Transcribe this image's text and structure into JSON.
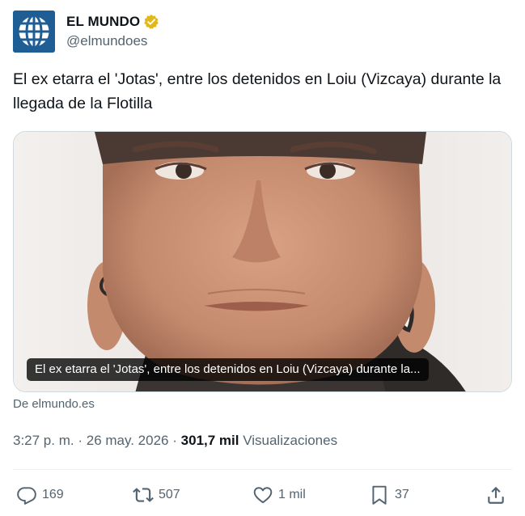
{
  "account": {
    "name": "EL MUNDO",
    "handle": "@elmundoes"
  },
  "tweet": {
    "text": "El ex etarra el 'Jotas', entre los detenidos en Loiu (Vizcaya) durante la llegada de la Flotilla"
  },
  "card": {
    "title": "El ex etarra el 'Jotas', entre los detenidos en Loiu (Vizcaya) durante la...",
    "source": "De elmundo.es"
  },
  "meta": {
    "time": "3:27 p. m.",
    "separator": "·",
    "date": "26 may. 2026",
    "views_count": "301,7 mil",
    "views_label": "Visualizaciones"
  },
  "actions": {
    "replies": "169",
    "reposts": "507",
    "likes": "1 mil",
    "bookmarks": "37"
  },
  "colors": {
    "text": "#0f1419",
    "secondary": "#536471",
    "avatar_blue": "#1f5d95",
    "verified_gold": "#e2b719",
    "border": "#cfd9de"
  },
  "icons": [
    "verified-badge-icon",
    "reply-icon",
    "repost-icon",
    "like-icon",
    "bookmark-icon",
    "share-icon"
  ]
}
